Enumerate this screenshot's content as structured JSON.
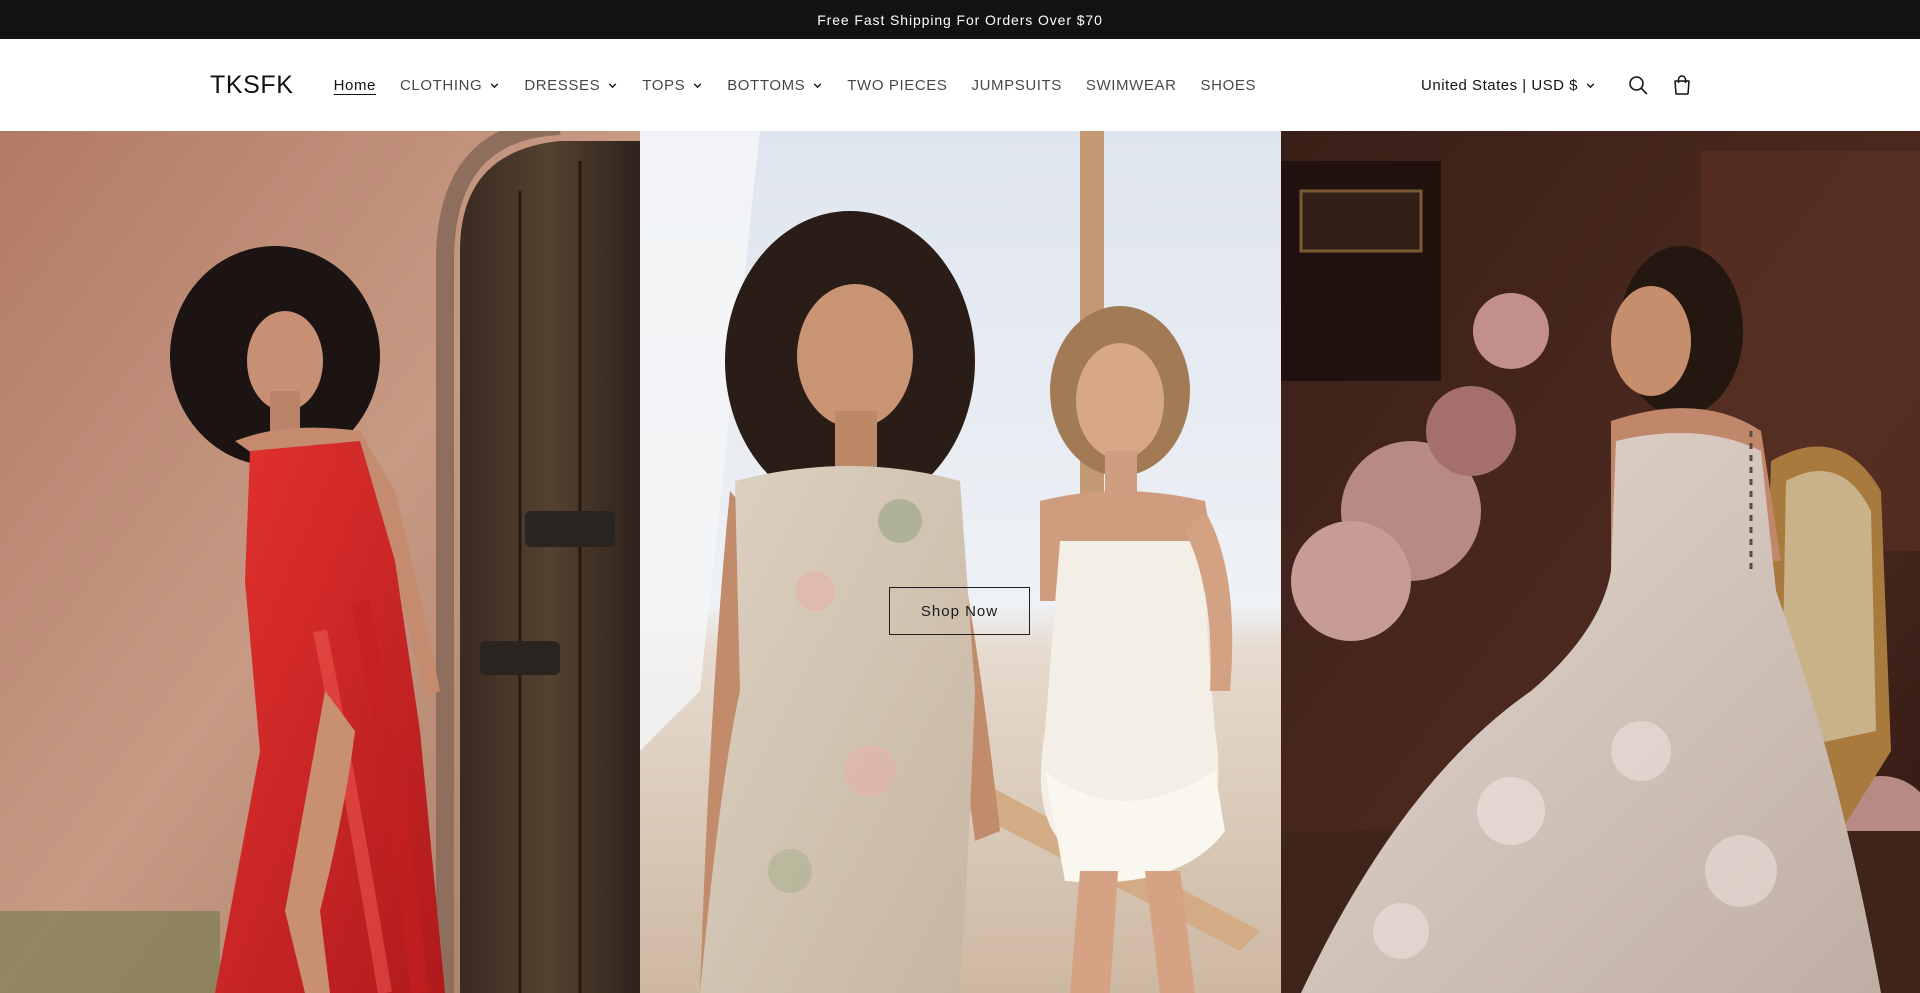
{
  "announcement": {
    "text": "Free Fast Shipping For Orders Over $70"
  },
  "header": {
    "logo": "TKSFK",
    "nav": [
      {
        "label": "Home",
        "active": true,
        "dropdown": false
      },
      {
        "label": "CLOTHING",
        "dropdown": true
      },
      {
        "label": "DRESSES",
        "dropdown": true
      },
      {
        "label": "TOPS",
        "dropdown": true
      },
      {
        "label": "BOTTOMS",
        "dropdown": true
      },
      {
        "label": "TWO PIECES",
        "dropdown": false
      },
      {
        "label": "JUMPSUITS",
        "dropdown": false
      },
      {
        "label": "SWIMWEAR",
        "dropdown": false
      },
      {
        "label": "SHOES",
        "dropdown": false
      }
    ],
    "locale": "United States | USD $",
    "icons": [
      "search-icon",
      "cart-icon"
    ]
  },
  "hero": {
    "button_label": "Shop Now"
  }
}
